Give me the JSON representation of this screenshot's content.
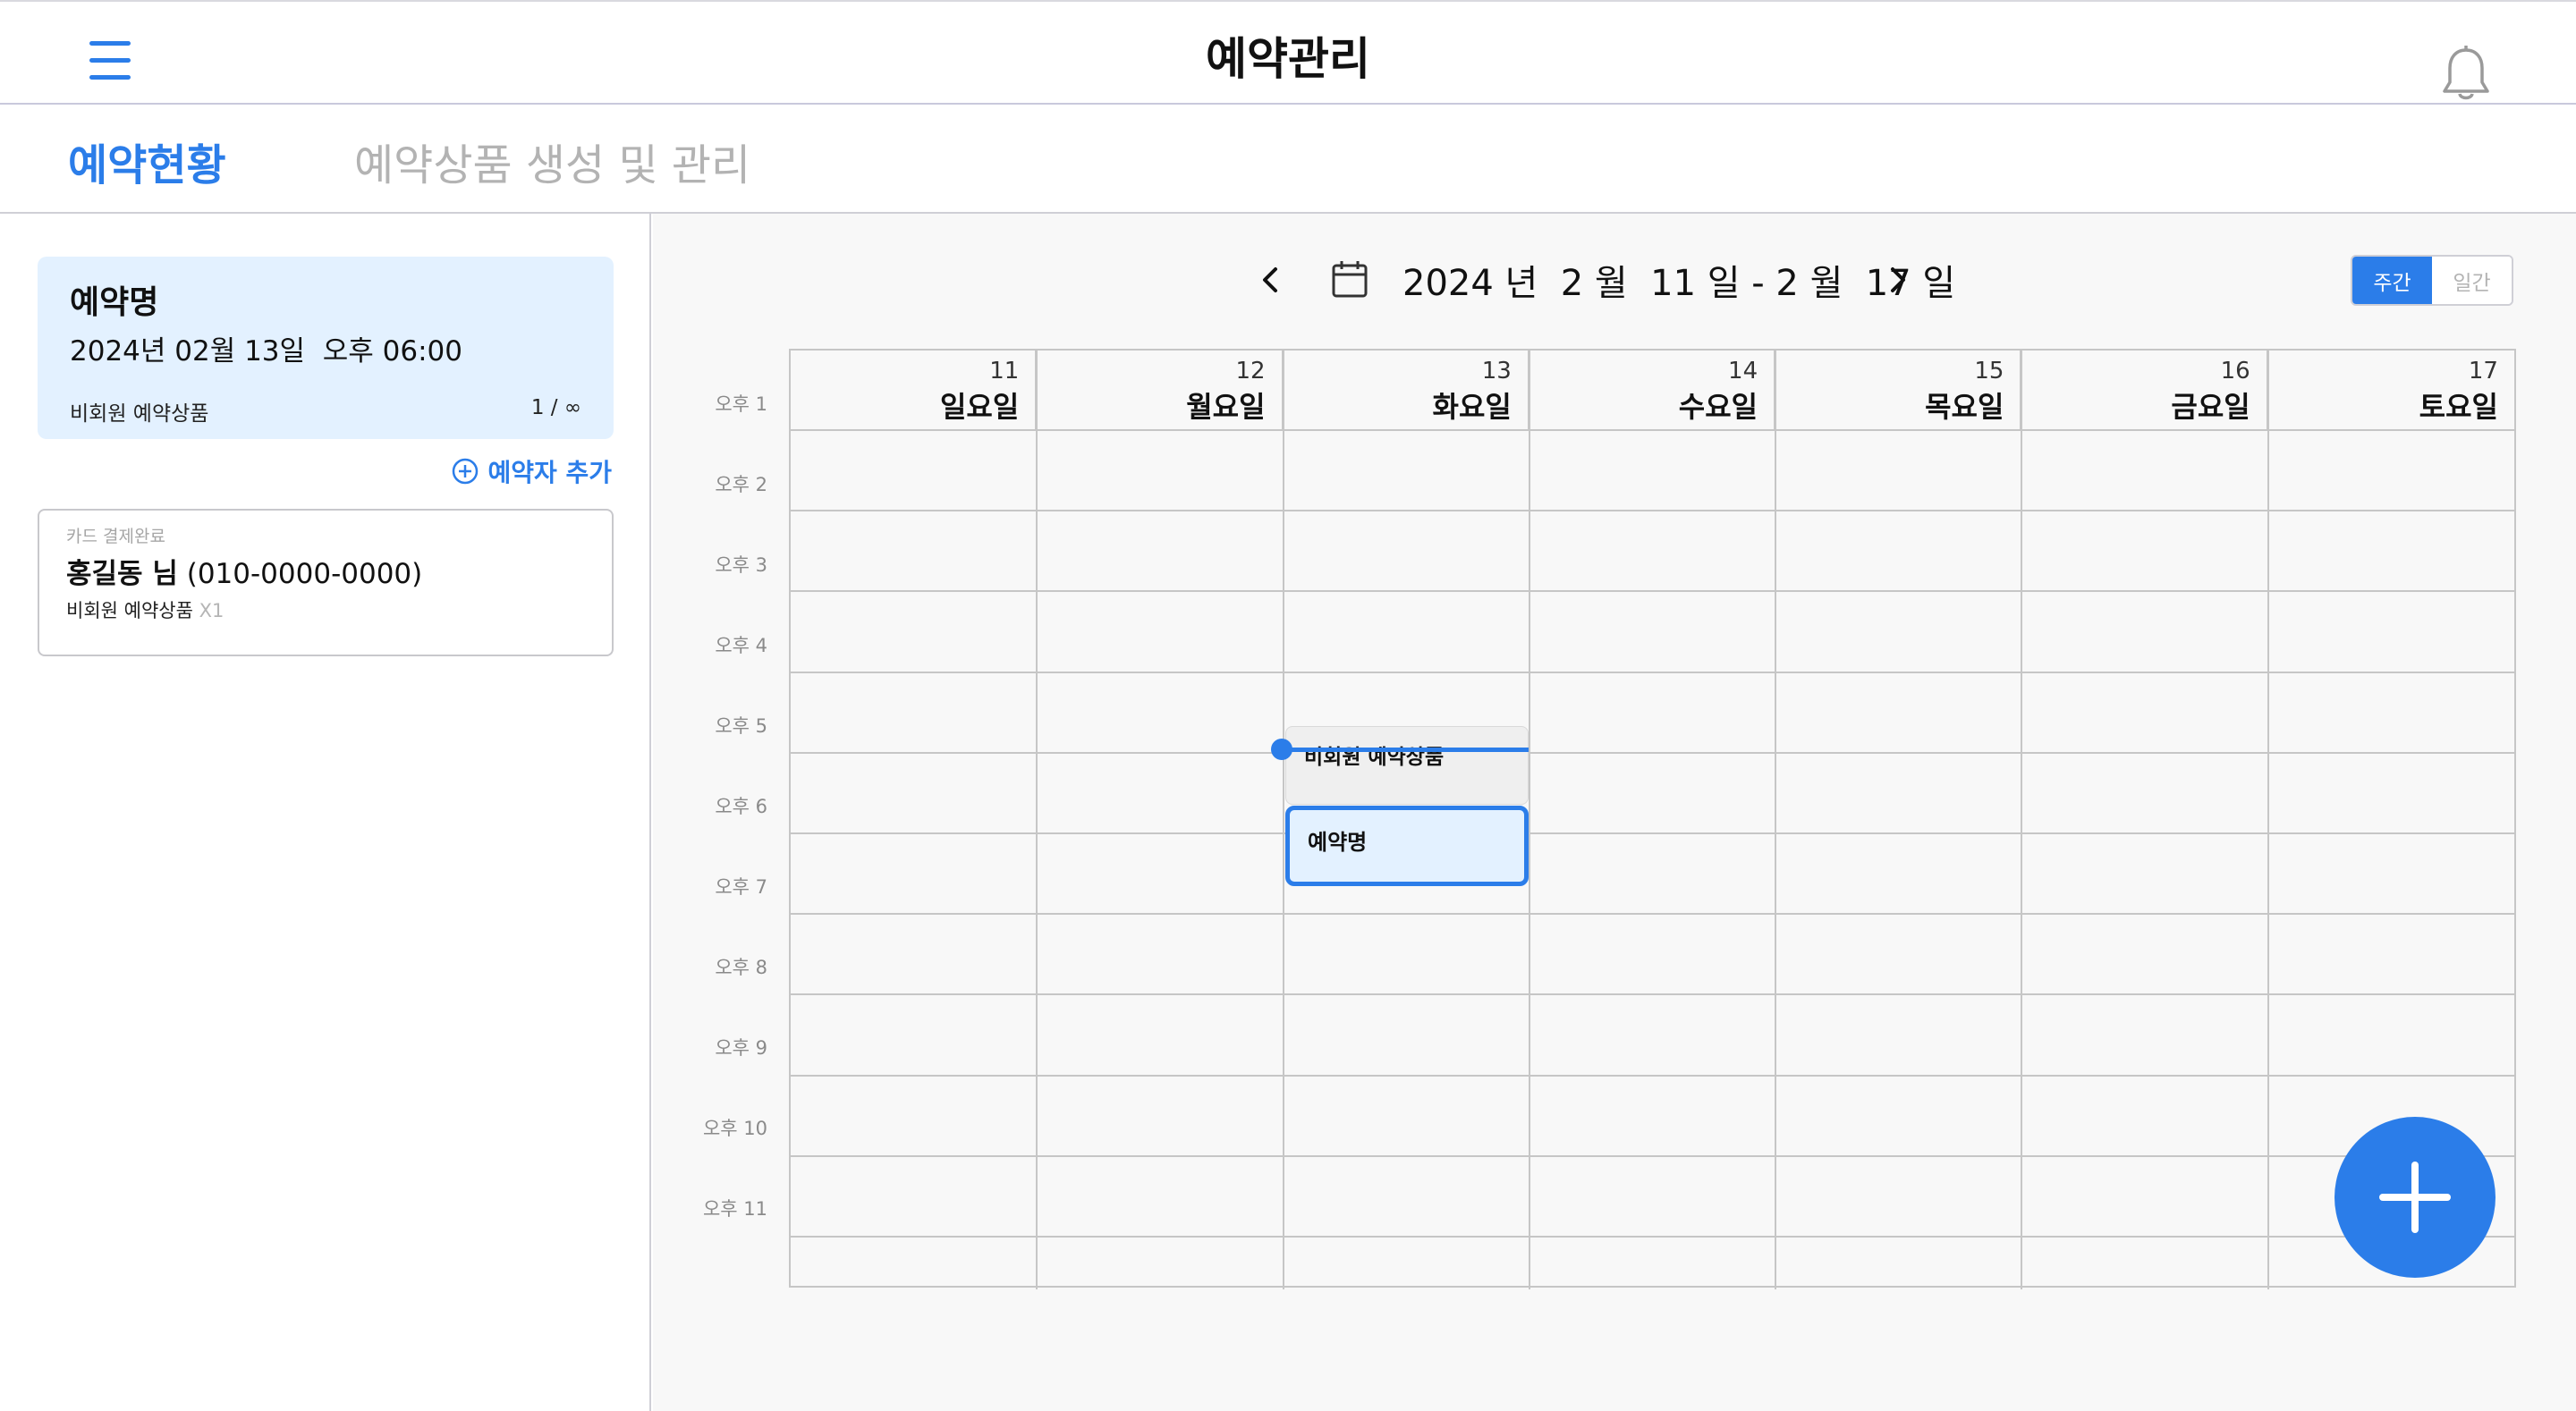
{
  "header": {
    "title": "예약관리",
    "menu_icon": "hamburger-menu-icon",
    "notification_icon": "bell-icon"
  },
  "tabs": [
    {
      "label": "예약현황",
      "active": true
    },
    {
      "label": "예약상품 생성 및 관리",
      "active": false
    }
  ],
  "sidebar": {
    "reservation": {
      "name": "예약명",
      "datetime": "2024년 02월 13일  오후 06:00",
      "product": "비회원 예약상품",
      "capacity": "1 / ∞"
    },
    "add_booker_label": "예약자 추가",
    "add_booker_icon": "plus-circle-icon",
    "booker": {
      "status": "카드 결제완료",
      "name": "홍길동 님",
      "phone": "(010-0000-0000)",
      "product": "비회원 예약상품",
      "quantity": "X1"
    }
  },
  "calendar": {
    "range_label": "2024 년  2 월  11 일 - 2 월  17 일",
    "prev_icon": "chevron-left-icon",
    "next_icon": "chevron-right-icon",
    "calendar_icon": "calendar-icon",
    "view_toggle": {
      "week": "주간",
      "day": "일간",
      "selected": "week"
    },
    "days": [
      {
        "num": "11",
        "name": "일요일"
      },
      {
        "num": "12",
        "name": "월요일"
      },
      {
        "num": "13",
        "name": "화요일"
      },
      {
        "num": "14",
        "name": "수요일"
      },
      {
        "num": "15",
        "name": "목요일"
      },
      {
        "num": "16",
        "name": "금요일"
      },
      {
        "num": "17",
        "name": "토요일"
      }
    ],
    "times": [
      "오후 1",
      "오후 2",
      "오후 3",
      "오후 4",
      "오후 5",
      "오후 6",
      "오후 7",
      "오후 8",
      "오후 9",
      "오후 10",
      "오후 11"
    ],
    "events": [
      {
        "label": "비회원 예약상품",
        "day": "13",
        "time": "오후 5",
        "style": "product"
      },
      {
        "label": "예약명",
        "day": "13",
        "time": "오후 6",
        "style": "reservation"
      }
    ],
    "accent_color": "#2b7de9",
    "add_icon": "plus-icon"
  }
}
